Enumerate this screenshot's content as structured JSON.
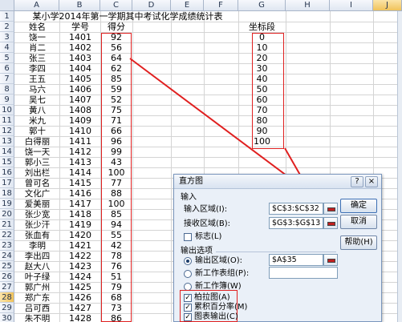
{
  "sheet": {
    "columns": [
      "A",
      "B",
      "C",
      "D",
      "E",
      "F",
      "G",
      "H",
      "I",
      "J"
    ],
    "rows": [
      "1",
      "2",
      "3",
      "4",
      "5",
      "6",
      "7",
      "8",
      "9",
      "10",
      "11",
      "12",
      "13",
      "14",
      "15",
      "16",
      "17",
      "18",
      "19",
      "20",
      "21",
      "22",
      "23",
      "24",
      "25",
      "26",
      "27",
      "28",
      "29",
      "30"
    ],
    "active_column": "J",
    "active_row": "28",
    "title": "某小学2014年第一学期其中考试化学成绩统计表",
    "headers": {
      "name": "姓名",
      "id": "学号",
      "score": "得分",
      "bins": "坐标段"
    },
    "students": [
      {
        "name": "饶一",
        "id": "1401",
        "score": "92"
      },
      {
        "name": "肖二",
        "id": "1402",
        "score": "56"
      },
      {
        "name": "张三",
        "id": "1403",
        "score": "64"
      },
      {
        "name": "李四",
        "id": "1404",
        "score": "62"
      },
      {
        "name": "王五",
        "id": "1405",
        "score": "85"
      },
      {
        "name": "马六",
        "id": "1406",
        "score": "59"
      },
      {
        "name": "吴七",
        "id": "1407",
        "score": "52"
      },
      {
        "name": "黄八",
        "id": "1408",
        "score": "75"
      },
      {
        "name": "米九",
        "id": "1409",
        "score": "71"
      },
      {
        "name": "郭十",
        "id": "1410",
        "score": "66"
      },
      {
        "name": "白得丽",
        "id": "1411",
        "score": "96"
      },
      {
        "name": "饶一天",
        "id": "1412",
        "score": "99"
      },
      {
        "name": "郭小三",
        "id": "1413",
        "score": "43"
      },
      {
        "name": "刘出栏",
        "id": "1414",
        "score": "100"
      },
      {
        "name": "曾可名",
        "id": "1415",
        "score": "77"
      },
      {
        "name": "文化广",
        "id": "1416",
        "score": "88"
      },
      {
        "name": "爱美丽",
        "id": "1417",
        "score": "100"
      },
      {
        "name": "张少宽",
        "id": "1418",
        "score": "85"
      },
      {
        "name": "张少汗",
        "id": "1419",
        "score": "94"
      },
      {
        "name": "张血有",
        "id": "1420",
        "score": "55"
      },
      {
        "name": "李明",
        "id": "1421",
        "score": "42"
      },
      {
        "name": "李出四",
        "id": "1422",
        "score": "78"
      },
      {
        "name": "赵大八",
        "id": "1423",
        "score": "76"
      },
      {
        "name": "叶子绿",
        "id": "1424",
        "score": "51"
      },
      {
        "name": "郭广州",
        "id": "1425",
        "score": "79"
      },
      {
        "name": "郑广东",
        "id": "1426",
        "score": "68"
      },
      {
        "name": "吕可西",
        "id": "1427",
        "score": "73"
      },
      {
        "name": "朱不明",
        "id": "1428",
        "score": "86"
      }
    ],
    "bins": [
      "0",
      "10",
      "20",
      "30",
      "40",
      "50",
      "60",
      "70",
      "80",
      "90",
      "100"
    ]
  },
  "dialog": {
    "title": "直方图",
    "close_label": "×",
    "help_label": "?",
    "input_section": "输入",
    "input_range_label": "输入区域(I):",
    "input_range_value": "$C$3:$C$32",
    "bin_range_label": "接收区域(B):",
    "bin_range_value": "$G$3:$G$13",
    "labels_label": "标志(L)",
    "output_section": "输出选项",
    "output_range_label": "输出区域(O):",
    "output_range_value": "$A$35",
    "new_sheet_label": "新工作表组(P):",
    "new_sheet_value": "",
    "new_workbook_label": "新工作簿(W)",
    "pareto_label": "柏拉图(A)",
    "cumulative_label": "累积百分率(M)",
    "chart_label": "图表输出(C)",
    "ok_label": "确定",
    "cancel_label": "取消",
    "help_button_label": "帮助(H)",
    "checked_mark": "✓"
  },
  "colors": {
    "highlight_red": "#e02020",
    "dialog_bg": "#eaf0f8",
    "header_active": "#f0c25a"
  }
}
